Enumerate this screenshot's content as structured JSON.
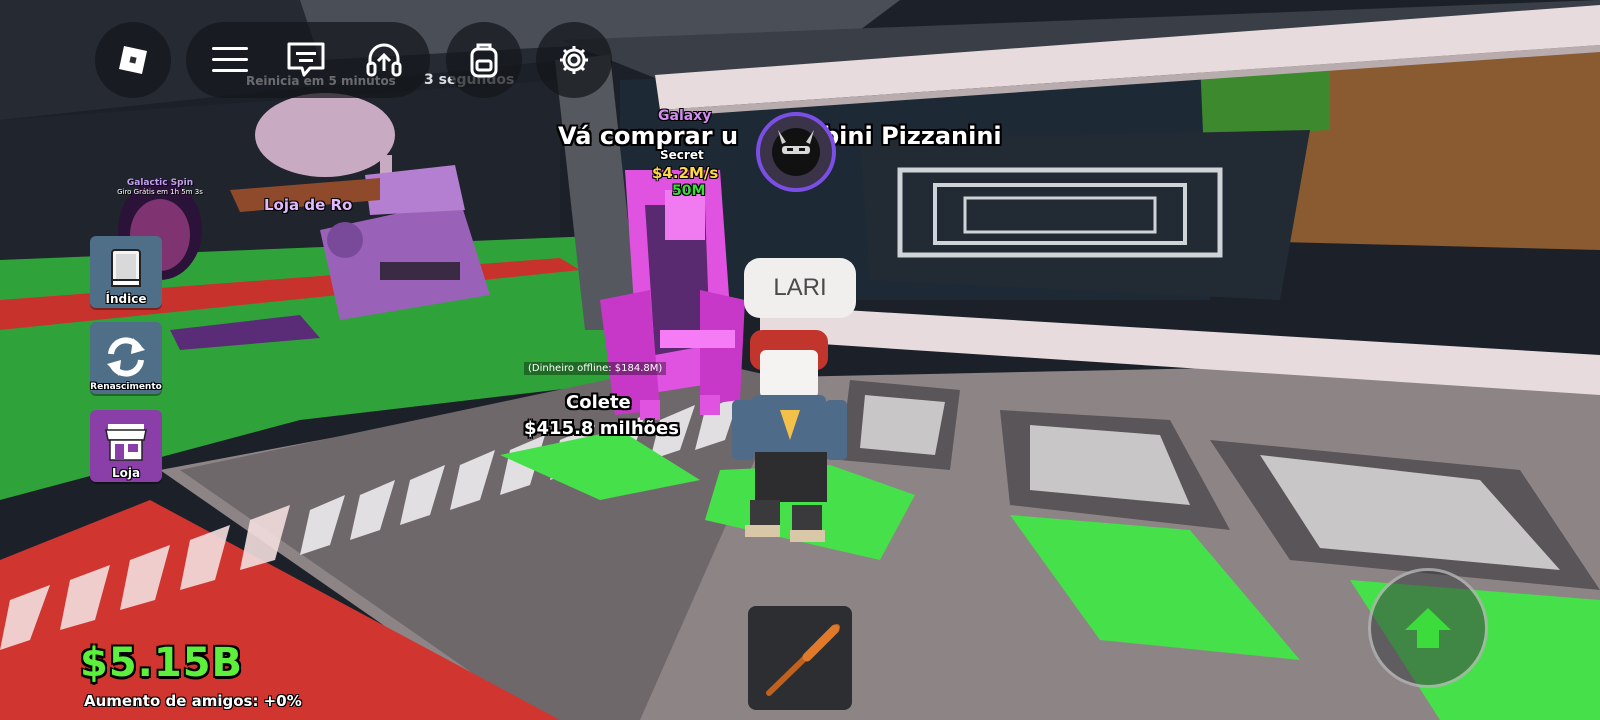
{
  "topbar": {
    "roblox_icon": "roblox-logo-icon",
    "menu_icon": "hamburger-menu-icon",
    "chat_icon": "chat-bubble-icon",
    "voice_icon": "headset-icon",
    "backpack_icon": "backpack-icon",
    "settings_icon": "gear-icon",
    "timer_line": "3 segundos",
    "reset_text": "Reinicia em 5 minutos"
  },
  "sidebar": {
    "items": [
      {
        "label": "Índice",
        "icon": "book-icon",
        "color": "#4a6b84"
      },
      {
        "label": "Renascimento",
        "icon": "refresh-icon",
        "color": "#4a6b84"
      },
      {
        "label": "Loja",
        "icon": "storefront-icon",
        "color": "#8a3fa8"
      }
    ]
  },
  "world": {
    "spin_sign_title": "Galactic Spin",
    "spin_sign_sub": "Giro Grátis em 1h 5m 3s",
    "shop_sign": "Loja de Ro",
    "banner_text": "Vá comprar um Tralalero... Lirili bini Pizzanini",
    "banner_left": "Vá comprar u",
    "banner_right": "bini Pizzanini",
    "galaxy_label": "Galaxy",
    "secret_label": "Secret",
    "income_label": "$4.2M/s",
    "price_label": "50M",
    "offline_money": "(Dinheiro offline: $184.8M)",
    "collect_label": "Colete",
    "collect_amount": "$415.8 milhões",
    "player_name": "LARI"
  },
  "hud": {
    "money": "$5.15B",
    "friends_boost": "Aumento de amigos: +0%",
    "money_color": "#5cf03c",
    "hotbar_item": "bat-icon",
    "jump_button": "jump-arrow-icon",
    "jump_color": "#3ddc3d"
  }
}
